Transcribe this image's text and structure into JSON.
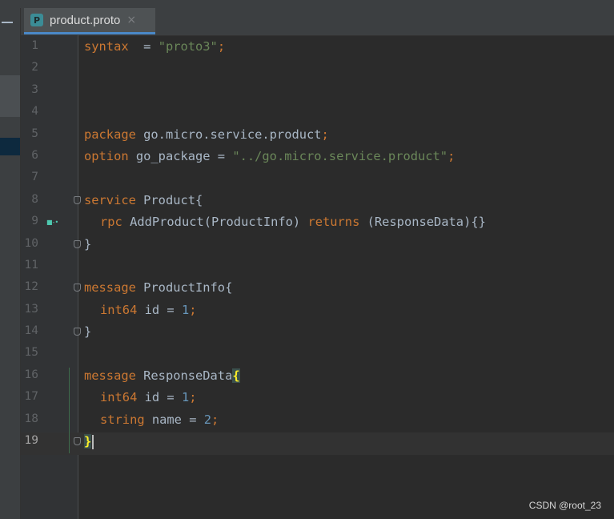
{
  "tab": {
    "icon_letter": "P",
    "filename": "product.proto",
    "close_glyph": "×"
  },
  "lines": [
    {
      "n": "1",
      "tokens": [
        {
          "t": "syntax",
          "c": "kw"
        },
        {
          "t": "  = ",
          "c": "plain"
        },
        {
          "t": "\"proto3\"",
          "c": "str"
        },
        {
          "t": ";",
          "c": "kw"
        }
      ]
    },
    {
      "n": "2",
      "tokens": []
    },
    {
      "n": "3",
      "tokens": []
    },
    {
      "n": "4",
      "tokens": []
    },
    {
      "n": "5",
      "tokens": [
        {
          "t": "package",
          "c": "kw"
        },
        {
          "t": " go.micro.service.product",
          "c": "plain"
        },
        {
          "t": ";",
          "c": "kw"
        }
      ]
    },
    {
      "n": "6",
      "tokens": [
        {
          "t": "option",
          "c": "kw"
        },
        {
          "t": " go_package = ",
          "c": "plain"
        },
        {
          "t": "\"../go.micro.service.product\"",
          "c": "str"
        },
        {
          "t": ";",
          "c": "kw"
        }
      ]
    },
    {
      "n": "7",
      "tokens": []
    },
    {
      "n": "8",
      "fold": true,
      "tokens": [
        {
          "t": "service",
          "c": "kw"
        },
        {
          "t": " Product{",
          "c": "plain"
        }
      ]
    },
    {
      "n": "9",
      "impl": true,
      "indent": true,
      "tokens": [
        {
          "t": "rpc",
          "c": "kw"
        },
        {
          "t": " AddProduct(ProductInfo) ",
          "c": "plain"
        },
        {
          "t": "returns",
          "c": "kw"
        },
        {
          "t": " (ResponseData){}",
          "c": "plain"
        }
      ]
    },
    {
      "n": "10",
      "fold": true,
      "tokens": [
        {
          "t": "}",
          "c": "plain"
        }
      ]
    },
    {
      "n": "11",
      "tokens": []
    },
    {
      "n": "12",
      "fold": true,
      "tokens": [
        {
          "t": "message",
          "c": "kw"
        },
        {
          "t": " ProductInfo{",
          "c": "plain"
        }
      ]
    },
    {
      "n": "13",
      "indent": true,
      "tokens": [
        {
          "t": "int64",
          "c": "kw"
        },
        {
          "t": " id = ",
          "c": "plain"
        },
        {
          "t": "1",
          "c": "num"
        },
        {
          "t": ";",
          "c": "kw"
        }
      ]
    },
    {
      "n": "14",
      "fold": true,
      "tokens": [
        {
          "t": "}",
          "c": "plain"
        }
      ]
    },
    {
      "n": "15",
      "tokens": []
    },
    {
      "n": "16",
      "tokens": [
        {
          "t": "message",
          "c": "kw"
        },
        {
          "t": " ResponseData",
          "c": "plain"
        },
        {
          "t": "{",
          "c": "brmatch"
        }
      ]
    },
    {
      "n": "17",
      "indent": true,
      "tokens": [
        {
          "t": "int64",
          "c": "kw"
        },
        {
          "t": " id = ",
          "c": "plain"
        },
        {
          "t": "1",
          "c": "num"
        },
        {
          "t": ";",
          "c": "kw"
        }
      ]
    },
    {
      "n": "18",
      "indent": true,
      "tokens": [
        {
          "t": "string",
          "c": "kw"
        },
        {
          "t": " name = ",
          "c": "plain"
        },
        {
          "t": "2",
          "c": "num"
        },
        {
          "t": ";",
          "c": "kw"
        }
      ]
    },
    {
      "n": "19",
      "fold": true,
      "current": true,
      "caret": true,
      "tokens": [
        {
          "t": "}",
          "c": "brmatch"
        }
      ]
    }
  ],
  "watermark": "CSDN @root_23",
  "colors": {
    "keyword": "#cc7832",
    "string": "#6a8759",
    "number": "#6897bb",
    "plain": "#a9b7c6",
    "background": "#2b2b2b",
    "tab_underline": "#4a88c7"
  }
}
